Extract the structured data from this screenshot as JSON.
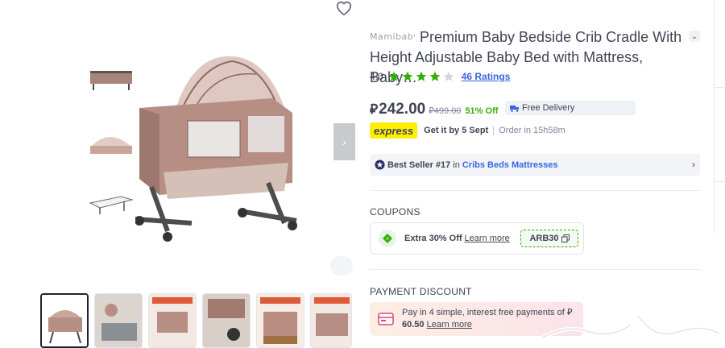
{
  "product": {
    "brand": "Mamibaby",
    "title": "Premium Baby Bedside Crib Cradle With Height Adjustable Baby Bed with Mattress, Baby…",
    "rating_value": "4.0",
    "stars_filled": 4,
    "stars_total": 5,
    "ratings_link": "46 Ratings"
  },
  "pricing": {
    "currency_symbol": "⃁",
    "price": "242.00",
    "old_currency_symbol": "⃁",
    "old_price": "499.00",
    "discount": "51% Off",
    "free_delivery": "Free Delivery"
  },
  "delivery": {
    "badge": "express",
    "get_it": "Get it by 5 Sept",
    "order_in": "Order in 15h58m"
  },
  "bestseller": {
    "label": "Best Seller #17",
    "in": "in",
    "category": "Cribs Beds Mattresses"
  },
  "coupons": {
    "section_title": "COUPONS",
    "offer": "Extra 30% Off",
    "learn_more": "Learn more",
    "code": "ARB30"
  },
  "payment_discount": {
    "section_title": "PAYMENT DISCOUNT",
    "line1": "Pay in 4 simple, interest free payments of",
    "currency_symbol": "⃁",
    "amount": "60.50",
    "learn_more": "Learn more"
  },
  "gallery": {
    "thumbnails_count": 6,
    "active_index": 0
  },
  "colors": {
    "accent_blue": "#3866df",
    "star_green": "#38ae04",
    "express_yellow": "#feee00",
    "text_dark": "#404553",
    "muted": "#7e859b"
  },
  "icons": [
    "heart-icon",
    "chevron-down-icon",
    "star-icon",
    "truck-icon",
    "chevron-right-icon",
    "bestseller-badge-icon",
    "coupon-tag-icon",
    "copy-icon",
    "installment-card-icon"
  ]
}
